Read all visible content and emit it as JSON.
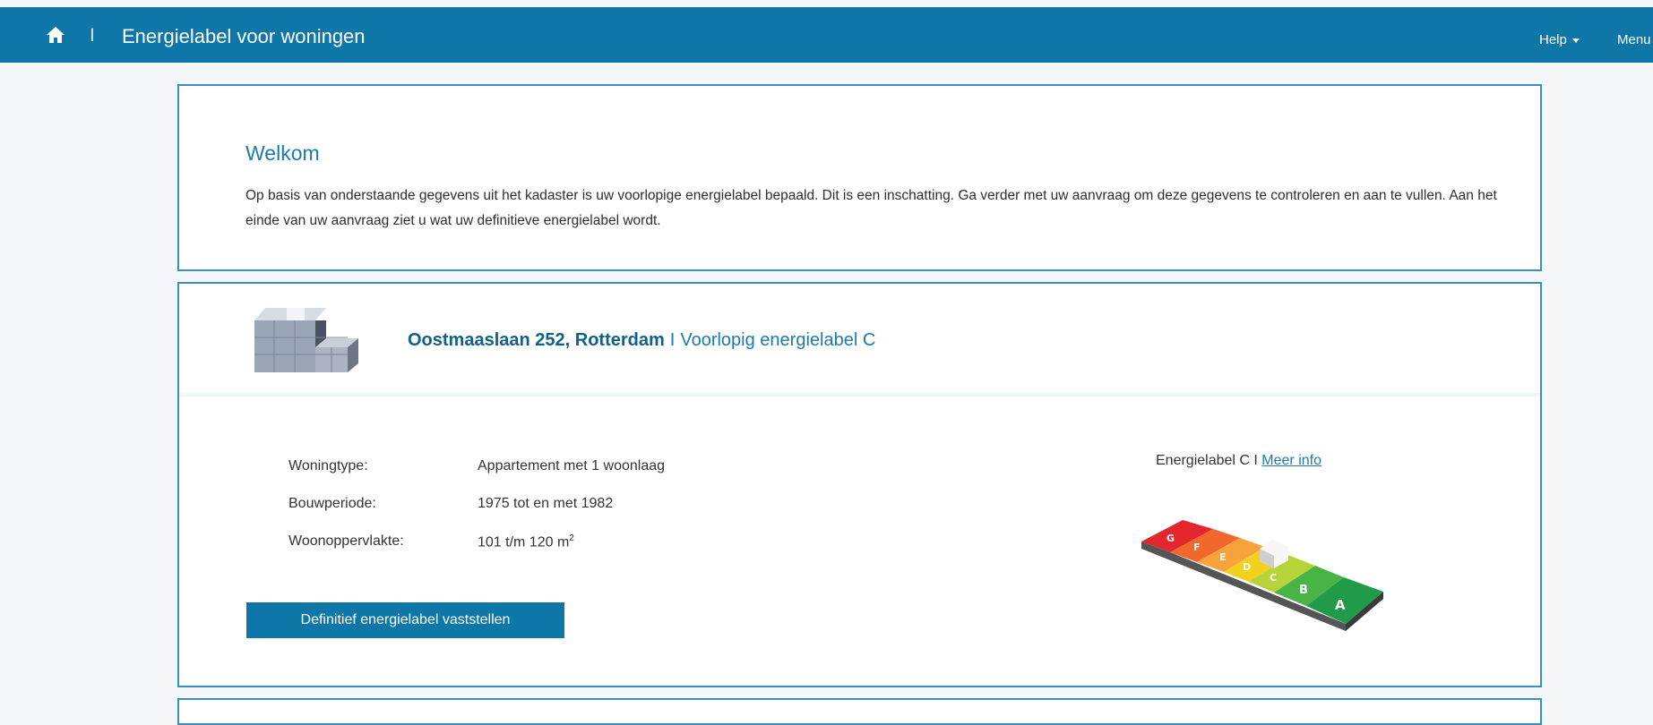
{
  "header": {
    "separator": "I",
    "title": "Energielabel voor woningen",
    "help_label": "Help",
    "menu_label": "Menu"
  },
  "welcome": {
    "title": "Welkom",
    "text": "Op basis van onderstaande gegevens uit het kadaster is uw voorlopige energielabel bepaald. Dit is een inschatting. Ga verder met uw aanvraag om deze gegevens te controleren en aan te vullen. Aan het einde van uw aanvraag ziet u wat uw definitieve energielabel wordt."
  },
  "property": {
    "address": "Oostmaaslaan 252, Rotterdam",
    "separator": "I",
    "preliminary": "Voorlopig energielabel C",
    "details": [
      {
        "label": "Woningtype:",
        "value": "Appartement met 1 woonlaag"
      },
      {
        "label": "Bouwperiode:",
        "value": "1975 tot en met 1982"
      },
      {
        "label": "Woonoppervlakte:",
        "value": "101 t/m 120 m",
        "sup": "2"
      }
    ],
    "button_label": "Definitief energielabel vaststellen",
    "energy_label_text": "Energielabel C I ",
    "more_info_label": "Meer info",
    "scale_letters": [
      "G",
      "F",
      "E",
      "D",
      "C",
      "B",
      "A"
    ]
  },
  "colors": {
    "brand": "#0f77a8",
    "accent": "#1a7cac",
    "panel_border": "#3a8ec0"
  },
  "icons": {
    "home": "home-icon",
    "help_caret": "caret-down-icon",
    "property": "apartment-building-icon",
    "scale": "energy-label-scale-icon"
  }
}
